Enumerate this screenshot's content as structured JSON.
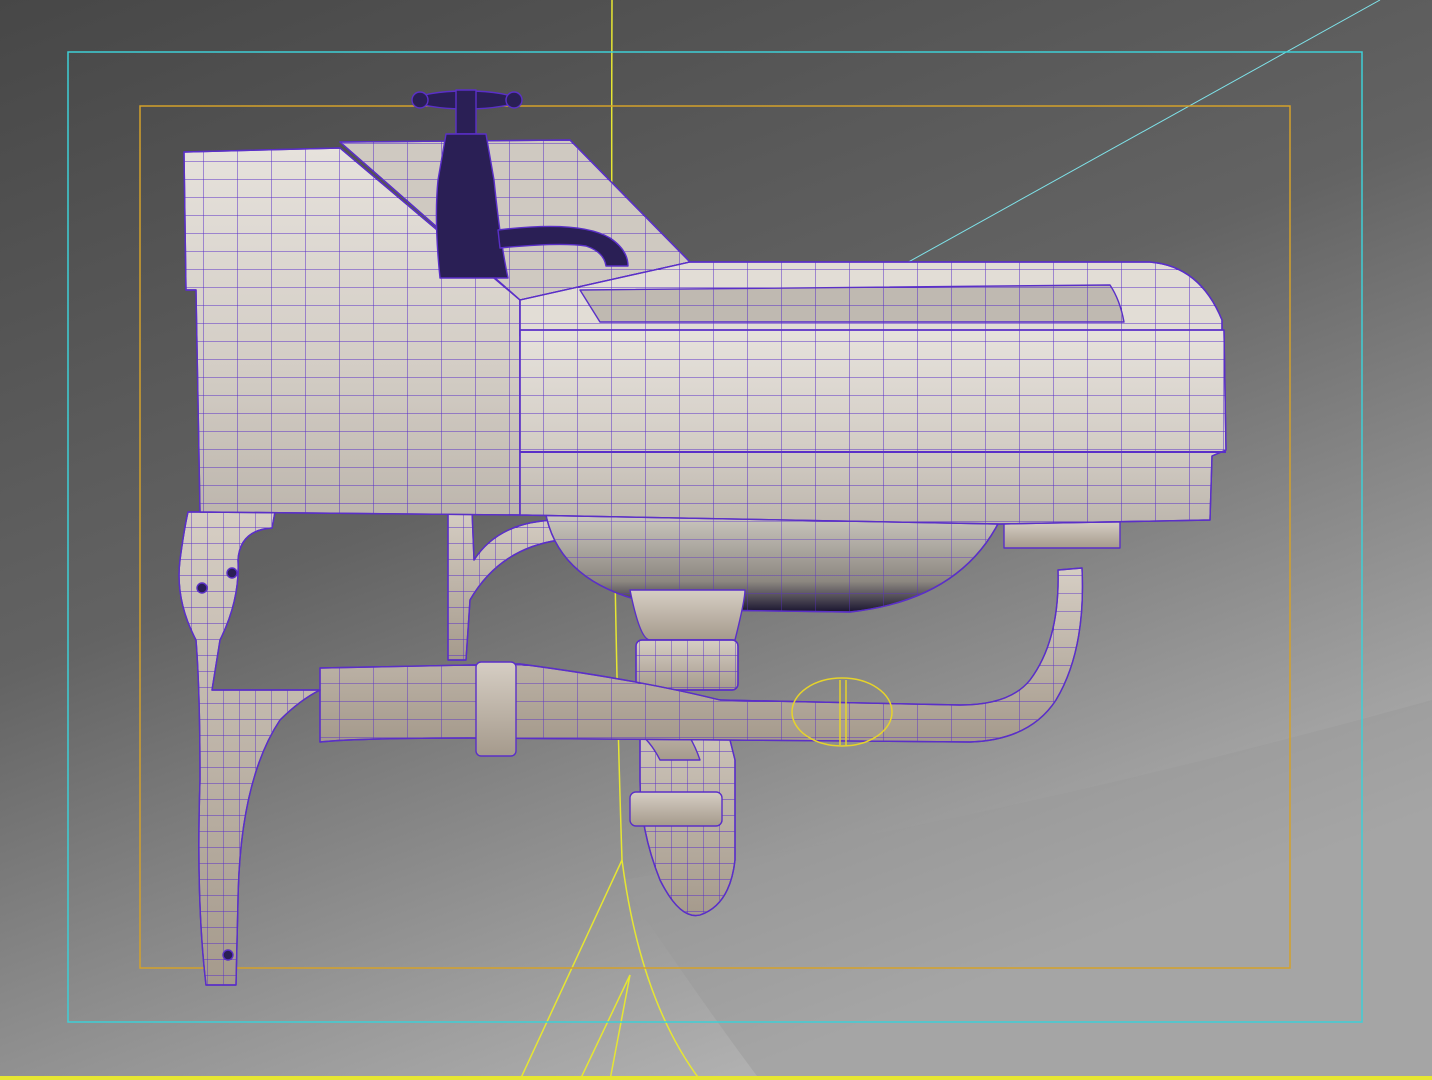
{
  "viewport": {
    "type": "3d-perspective-viewport",
    "shading": "smooth-shaded-with-wireframe-overlay",
    "wireframe_color": "#5a2fc8",
    "background_top": "#4a4a4a",
    "background_bottom": "#a8a8a8",
    "safe_frame_outer_color": "#3ecfd6",
    "safe_frame_inner_color": "#d4a12a",
    "guide_line_color": "#e6e632"
  },
  "scene": {
    "object": "wall-mounted-sink",
    "parts": [
      "basin",
      "backsplash",
      "cross-handle-tap",
      "spout",
      "bowl",
      "drain-tailpiece",
      "p-trap",
      "towel-rail-pipe",
      "wall-bracket-left",
      "wall-bracket-right"
    ],
    "porcelain_color": "#d8d3cc",
    "metal_color": "#c9bfb3",
    "tap_color": "#2a1f55"
  }
}
